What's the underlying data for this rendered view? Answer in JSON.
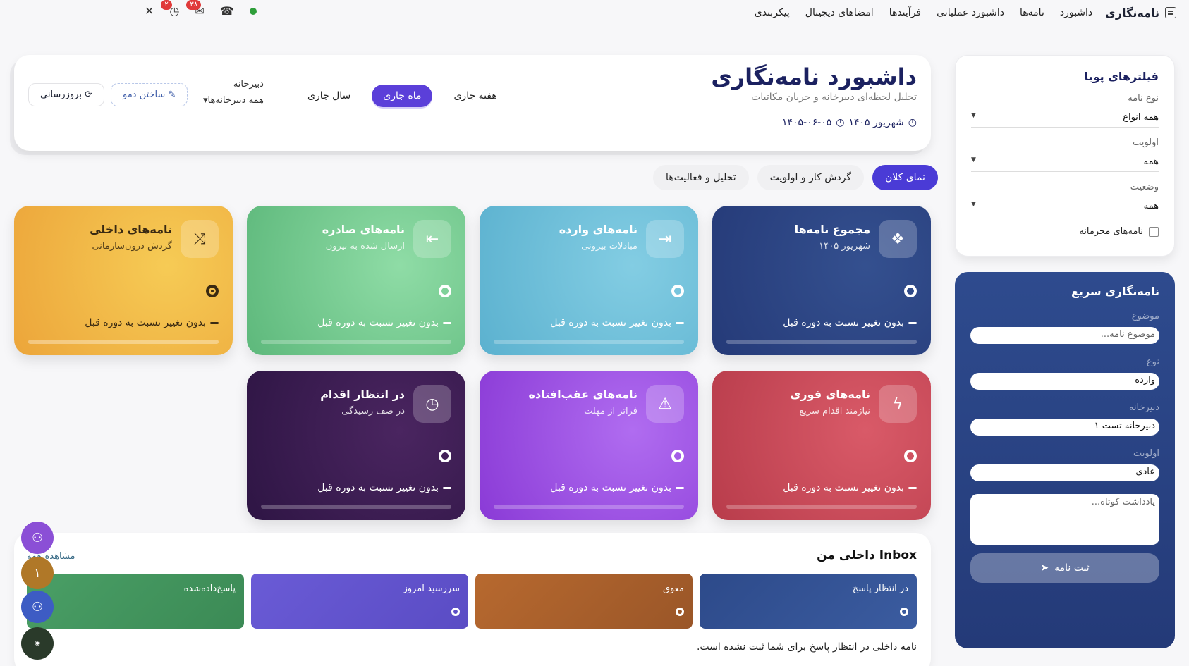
{
  "nav": {
    "brand": "نامه‌نگاری",
    "items": [
      "داشبورد",
      "نامه‌ها",
      "داشبورد عملیاتی",
      "فرآیندها",
      "امضاهای دیجیتال",
      "پیکربندی"
    ],
    "badge_messages": "۳۸",
    "badge_history": "۲"
  },
  "header": {
    "title": "داشبورد نامه‌نگاری",
    "subtitle": "تحلیل لحظه‌ای دبیرخانه و جریان مکاتبات",
    "date_month": "شهریور ۱۴۰۵",
    "date_full": "۱۴۰۵-۰۶-۰۵",
    "periods": [
      "هفته جاری",
      "ماه جاری",
      "سال جاری"
    ],
    "active_period": "ماه جاری",
    "secretariat_label": "دبیرخانه",
    "secretariat_value": "همه دبیرخانه‌ها",
    "demo_button": "ساختن دمو",
    "refresh_button": "بروزرسانی"
  },
  "tabs": [
    "نمای کلان",
    "گردش کار و اولویت",
    "تحلیل و فعالیت‌ها"
  ],
  "cards": [
    {
      "title": "مجموع نامه‌ها",
      "sub": "شهریور ۱۴۰۵",
      "change": "بدون تغییر نسبت به دوره قبل",
      "icon": "cubes-icon"
    },
    {
      "title": "نامه‌های وارده",
      "sub": "مبادلات بیرونی",
      "change": "بدون تغییر نسبت به دوره قبل",
      "icon": "sign-in-icon"
    },
    {
      "title": "نامه‌های صادره",
      "sub": "ارسال شده به بیرون",
      "change": "بدون تغییر نسبت به دوره قبل",
      "icon": "sign-out-icon"
    },
    {
      "title": "نامه‌های داخلی",
      "sub": "گردش درون‌سازمانی",
      "change": "بدون تغییر نسبت به دوره قبل",
      "icon": "shuffle-icon"
    },
    {
      "title": "نامه‌های فوری",
      "sub": "نیازمند اقدام سریع",
      "change": "بدون تغییر نسبت به دوره قبل",
      "icon": "bolt-icon"
    },
    {
      "title": "نامه‌های عقب‌افتاده",
      "sub": "فراتر از مهلت",
      "change": "بدون تغییر نسبت به دوره قبل",
      "icon": "warning-icon"
    },
    {
      "title": "در انتظار اقدام",
      "sub": "در صف رسیدگی",
      "change": "بدون تغییر نسبت به دوره قبل",
      "icon": "clock-icon"
    }
  ],
  "inbox": {
    "title": "Inbox داخلی من",
    "view_all": "مشاهده همه",
    "tiles": [
      "در انتظار پاسخ",
      "معوق",
      "سررسید امروز",
      "پاسخ‌داده‌شده"
    ],
    "empty": "نامه داخلی در انتظار پاسخ برای شما ثبت نشده است."
  },
  "filters": {
    "title": "فیلترهای پویا",
    "type_label": "نوع نامه",
    "type_value": "همه انواع",
    "priority_label": "اولویت",
    "priority_value": "همه",
    "status_label": "وضعیت",
    "status_value": "همه",
    "confidential_label": "نامه‌های محرمانه"
  },
  "quick": {
    "title": "نامه‌نگاری سریع",
    "subject_label": "موضوع",
    "subject_placeholder": "موضوع نامه...",
    "type_label": "نوع",
    "type_value": "وارده",
    "secretariat_label": "دبیرخانه",
    "secretariat_value": "دبیرخانه تست ۱",
    "priority_label": "اولویت",
    "priority_value": "عادی",
    "note_placeholder": "یادداشت کوتاه...",
    "submit": "ثبت نامه"
  },
  "float_badge": "۱",
  "colors": {
    "accent": "#5b3fd9",
    "navy": "#1b2160"
  }
}
